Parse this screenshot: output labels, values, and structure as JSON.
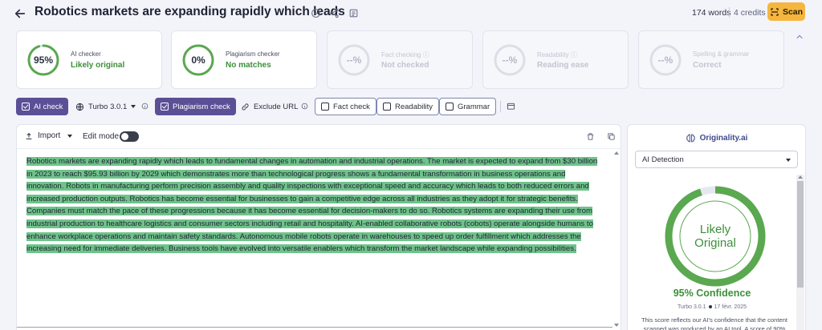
{
  "header": {
    "title": "Robotics markets are expanding rapidly which leads",
    "words": "174 words",
    "credits": "4 credits",
    "scan_label": "Scan"
  },
  "cards": [
    {
      "score": "95%",
      "label": "AI checker",
      "value": "Likely original",
      "progress": 0.95,
      "enabled": true
    },
    {
      "score": "0%",
      "label": "Plagiarism checker",
      "value": "No matches",
      "progress": 1.0,
      "enabled": true
    },
    {
      "score": "--%",
      "label": "Fact checking",
      "value": "Not checked",
      "progress": 0,
      "enabled": false
    },
    {
      "score": "--%",
      "label": "Readability",
      "value": "Reading ease",
      "progress": 0,
      "enabled": false
    },
    {
      "score": "--%",
      "label": "Spelling & grammar",
      "value": "Correct",
      "progress": 0,
      "enabled": false
    }
  ],
  "toolbar": {
    "ai_check": "AI check",
    "model": "Turbo 3.0.1",
    "plagiarism_check": "Plagiarism check",
    "exclude_url": "Exclude URL",
    "fact_check": "Fact check",
    "readability": "Readability",
    "grammar": "Grammar"
  },
  "editor": {
    "import_label": "Import",
    "edit_mode_label": "Edit mode",
    "edit_mode_on": false,
    "text": "Robotics markets are expanding rapidly which leads to fundamental changes in automation and industrial operations.  The market is expected to expand from $30 billion in 2023 to reach $95.93 billion by 2029 which demonstrates more than technological progress shows a fundamental transformation in business operations and innovation.  Robots in manufacturing perform precision assembly and quality inspections with exceptional speed and accuracy which leads to both reduced errors and increased production outputs.  Robotics has become essential for businesses to gain a competitive edge across all industries as they adopt it for strategic benefits.  Companies must match the pace of these progressions because it has become essential for decision-makers to do so.  Robotics systems are expanding their use from industrial production to healthcare logistics and consumer sectors including retail and hospitality.  AI-enabled collaborative robots (cobots) operate alongside humans to enhance workplace operations and maintain safety standards.  Autonomous mobile robots operate in warehouses to speed up order fulfillment which addresses the increasing need for immediate deliveries.  Business tools have evolved into versatile enablers which transform the market landscape while expanding possibilities."
  },
  "panel": {
    "brand": "Originality.ai",
    "select_value": "AI Detection",
    "ring_line1": "Likely",
    "ring_line2": "Original",
    "ring_progress": 0.95,
    "confidence": "95% Confidence",
    "model": "Turbo 3.0.1",
    "date": "17 févr. 2025",
    "description": "This score reflects our AI's confidence that the content scanned was produced by an AI tool. A score of 90%"
  },
  "colors": {
    "accent": "#5b4f96",
    "success": "#3c8f3a",
    "highlight": "#6fc38a",
    "scan": "#f5b63f"
  }
}
